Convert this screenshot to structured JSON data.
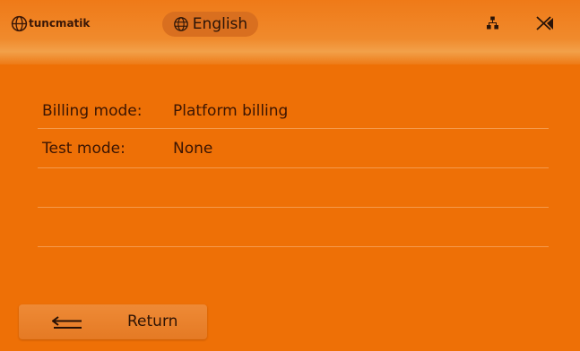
{
  "header": {
    "brand": "tuncmatik",
    "language": "English",
    "icons": [
      "logo-globe-icon",
      "globe-icon",
      "network-icon",
      "no-wifi-icon"
    ]
  },
  "info": {
    "rows": [
      {
        "label": "Billing mode:",
        "value": "Platform billing"
      },
      {
        "label": "Test mode:",
        "value": "None"
      }
    ]
  },
  "footer": {
    "return_label": "Return",
    "return_icon": "return-arrow-icon"
  },
  "colors": {
    "background": "#ee7006",
    "header_highlight": "#f2a049",
    "pill": "#d96f1f",
    "button": "#e57a24",
    "text": "#3b1503"
  }
}
